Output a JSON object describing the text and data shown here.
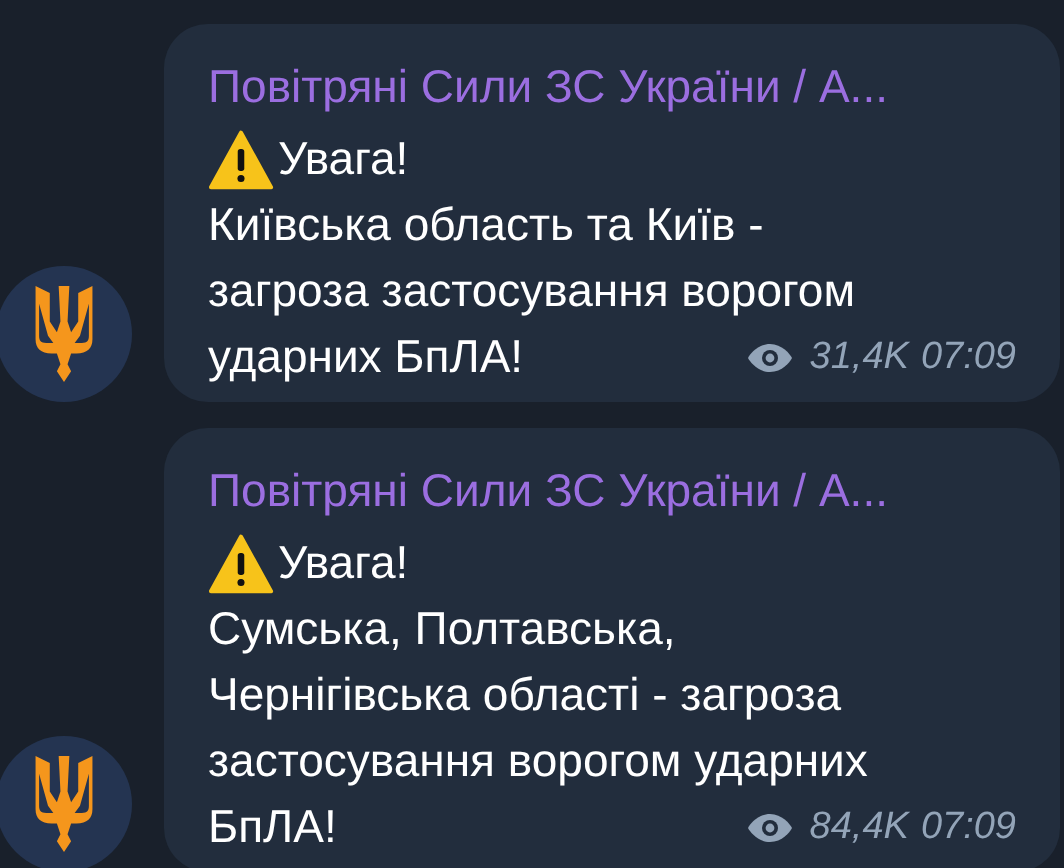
{
  "messages": [
    {
      "channel": "Повітряні Сили ЗС України / А...",
      "heading": "Увага!",
      "lines": [
        "Київська область та Київ -",
        "загроза застосування ворогом",
        "ударних БпЛА!"
      ],
      "views": "31,4K",
      "time": "07:09"
    },
    {
      "channel": "Повітряні Сили ЗС України / А...",
      "heading": "Увага!",
      "lines": [
        "Сумська, Полтавська,",
        "Чернігівська області - загроза",
        "застосування ворогом ударних",
        "БпЛА!"
      ],
      "views": "84,4K",
      "time": "07:09"
    }
  ]
}
